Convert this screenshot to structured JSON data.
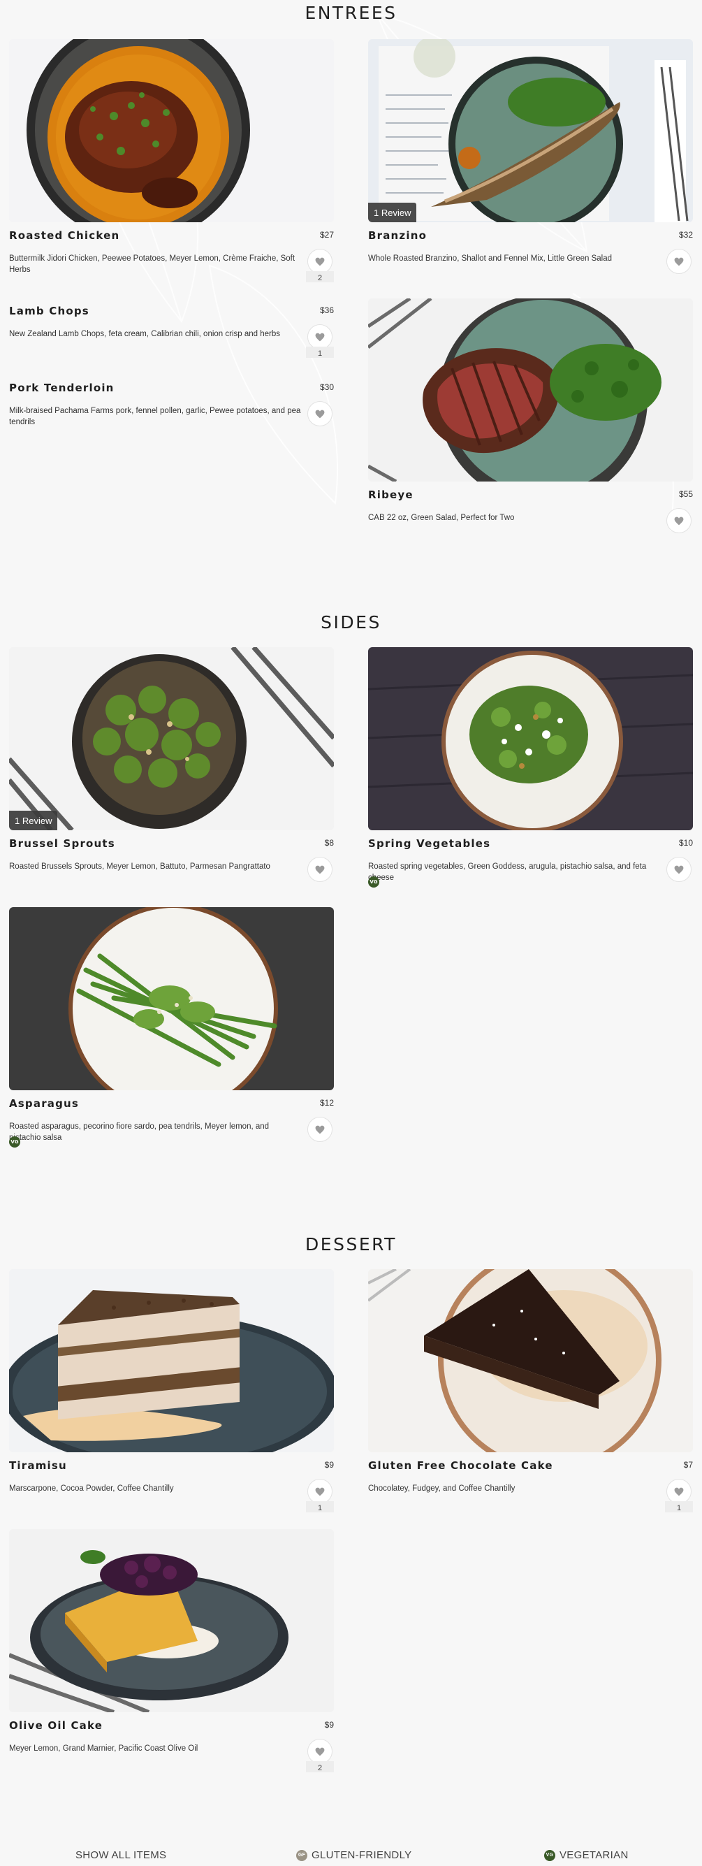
{
  "sections": [
    {
      "title": "ENTREES",
      "items": [
        {
          "name": "Roasted Chicken",
          "price": "$27",
          "desc": "Buttermilk Jidori Chicken, Peewee Potatoes, Meyer Lemon, Crème Fraiche, Soft Herbs",
          "fav_count": "2"
        },
        {
          "name": "Branzino",
          "price": "$32",
          "desc": "Whole Roasted Branzino, Shallot and Fennel Mix, Little Green Salad",
          "review": "1 Review"
        },
        {
          "name": "Lamb Chops",
          "price": "$36",
          "desc": "New Zealand Lamb Chops, feta cream, Calibrian chili, onion crisp and herbs",
          "fav_count": "1"
        },
        {
          "name": "Pork Tenderloin",
          "price": "$30",
          "desc": "Milk-braised Pachama Farms pork, fennel pollen, garlic, Pewee potatoes, and pea tendrils"
        },
        {
          "name": "Ribeye",
          "price": "$55",
          "desc": "CAB 22 oz, Green Salad, Perfect for Two"
        }
      ]
    },
    {
      "title": "SIDES",
      "items": [
        {
          "name": "Brussel Sprouts",
          "price": "$8",
          "desc": "Roasted Brussels Sprouts, Meyer Lemon, Battuto, Parmesan Pangrattato",
          "review": "1 Review"
        },
        {
          "name": "Spring Vegetables",
          "price": "$10",
          "desc": "Roasted spring vegetables, Green Goddess, arugula, pistachio salsa, and feta cheese",
          "badge": "VG"
        },
        {
          "name": "Asparagus",
          "price": "$12",
          "desc": "Roasted asparagus, pecorino fiore sardo, pea tendrils, Meyer lemon, and pistachio salsa",
          "badge": "VG"
        }
      ]
    },
    {
      "title": "DESSERT",
      "items": [
        {
          "name": "Tiramisu",
          "price": "$9",
          "desc": "Marscarpone, Cocoa Powder, Coffee Chantilly",
          "fav_count": "1"
        },
        {
          "name": "Gluten Free Chocolate Cake",
          "price": "$7",
          "desc": "Chocolatey, Fudgey, and Coffee Chantilly",
          "fav_count": "1"
        },
        {
          "name": "Olive Oil Cake",
          "price": "$9",
          "desc": "Meyer Lemon, Grand Marnier, Pacific Coast Olive Oil",
          "fav_count": "2"
        }
      ]
    }
  ],
  "footer": {
    "show_all": "SHOW ALL ITEMS",
    "gluten_friendly": "GLUTEN-FRIENDLY",
    "gf_badge": "GF",
    "vegetarian": "VEGETARIAN",
    "vg_badge": "VG"
  },
  "colors": {
    "background": "#f7f7f7",
    "vegetarian_badge": "#3a5a28",
    "gluten_badge": "#9a9385",
    "review_badge": "#3c3c3c"
  },
  "icons": {
    "favorite": "heart-icon"
  }
}
